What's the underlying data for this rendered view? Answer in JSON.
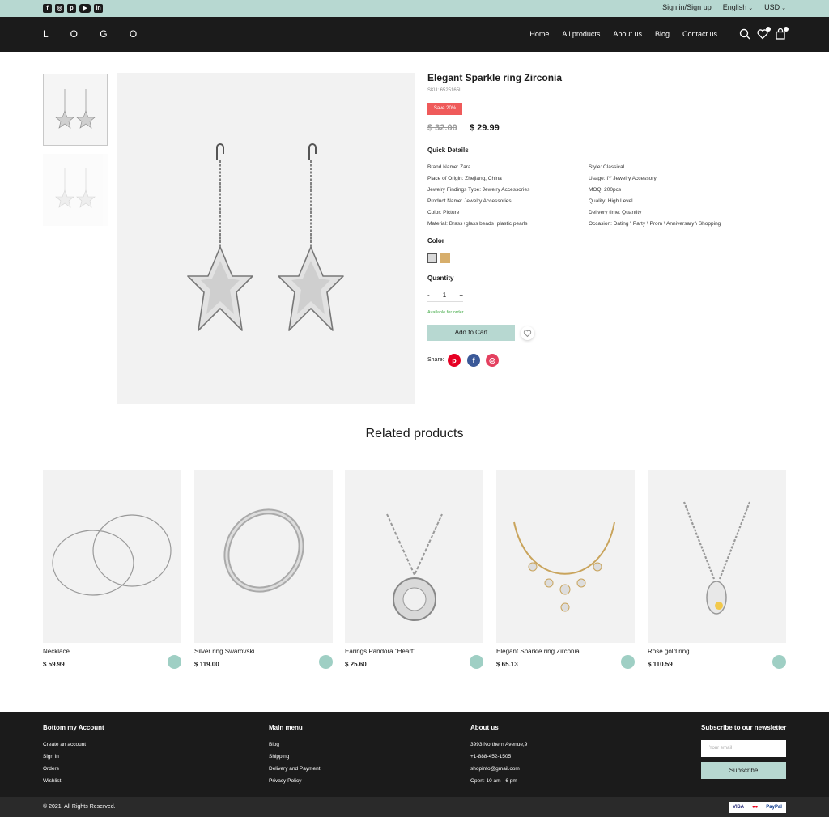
{
  "topbar": {
    "social_icons": [
      "facebook-icon",
      "instagram-icon",
      "pinterest-icon",
      "youtube-icon",
      "linkedin-icon"
    ],
    "signin": "Sign in/Sign up",
    "language": "English",
    "currency": "USD"
  },
  "header": {
    "logo": "L O G O",
    "nav": [
      "Home",
      "All products",
      "About us",
      "Blog",
      "Contact us"
    ],
    "icons": [
      "search-icon",
      "heart-icon",
      "bag-icon"
    ]
  },
  "product": {
    "title": "Elegant Sparkle ring Zirconia",
    "sku": "SKU: 6525165L",
    "save_badge": "Save 20%",
    "old_price": "$ 32.00",
    "new_price": "$ 29.99",
    "quick_details_title": "Quick Details",
    "details_left": [
      "Brand Name: Zara",
      "Place of Origin: Zhejiang, China",
      "Jewelry Findings Type: Jewelry Accessories",
      "Product Name: Jewelry Accessories",
      "Color: Picture",
      "Material: Brass+glass beads+plastic pearls"
    ],
    "details_right": [
      "Style: Classical",
      "Usage: IY Jewelry Accessory",
      "MOQ: 200pcs",
      "Quality: High Level",
      "Delivery time: Quantity",
      "Occasion: Dating \\ Party \\ Prom \\ Anniversary \\ Shopping"
    ],
    "color_title": "Color",
    "color_swatches": [
      "#d9d9d9",
      "#d7ae6b"
    ],
    "quantity_title": "Quantity",
    "qty_minus": "-",
    "qty_value": "1",
    "qty_plus": "+",
    "availability": "Available for order",
    "add_to_cart": "Add to Cart",
    "share_label": "Share:"
  },
  "related": {
    "title": "Related products",
    "items": [
      {
        "name": "Necklace",
        "price": "$ 59.99"
      },
      {
        "name": "Silver ring Swarovski",
        "price": "$ 119.00"
      },
      {
        "name": "Earings Pandora \"Heart\"",
        "price": "$ 25.60"
      },
      {
        "name": "Elegant Sparkle ring Zirconia",
        "price": "$ 65.13"
      },
      {
        "name": "Rose gold ring",
        "price": "$ 110.59"
      }
    ]
  },
  "footer": {
    "account": {
      "title": "Bottom my Account",
      "links": [
        "Create an account",
        "Sign in",
        "Orders",
        "Wishlist"
      ]
    },
    "menu": {
      "title": "Main menu",
      "links": [
        "Blog",
        "Shipping",
        "Delivery and Payment",
        "Privacy Policy"
      ]
    },
    "about": {
      "title": "About us",
      "lines": [
        "3993 Northern Avenue,9",
        "+1-888-452-1505",
        "shopinfo@gmail.com",
        "Open: 10 am - 6 pm"
      ]
    },
    "newsletter": {
      "title": "Subscribe to our newsletter",
      "placeholder": "Your email",
      "button": "Subscribe"
    },
    "copyright": "© 2021. All Rights Reserved.",
    "payments": [
      "VISA",
      "MasterCard",
      "PayPal"
    ]
  },
  "colors": {
    "accent": "#b7d8d1",
    "dark": "#1b1b1b",
    "sale": "#ef5a5a",
    "available": "#4caf50"
  }
}
